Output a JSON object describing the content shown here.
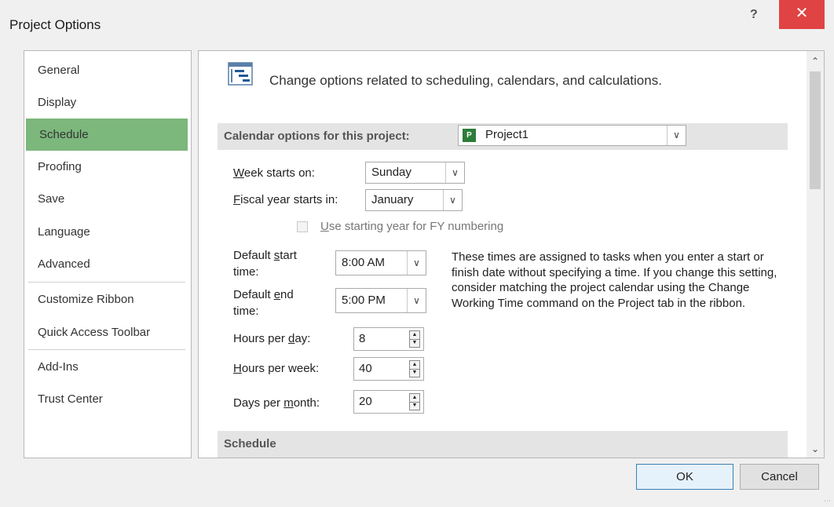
{
  "window": {
    "title": "Project Options",
    "help_label": "?",
    "close_label": "✕"
  },
  "nav": {
    "items": [
      {
        "label": "General"
      },
      {
        "label": "Display"
      },
      {
        "label": "Schedule",
        "selected": true
      },
      {
        "label": "Proofing"
      },
      {
        "label": "Save"
      },
      {
        "label": "Language"
      },
      {
        "label": "Advanced"
      },
      {
        "label": "Customize Ribbon"
      },
      {
        "label": "Quick Access Toolbar"
      },
      {
        "label": "Add-Ins"
      },
      {
        "label": "Trust Center"
      }
    ]
  },
  "main": {
    "header": "Change options related to scheduling, calendars, and calculations.",
    "calendar_section": {
      "label": "Calendar options for this project:",
      "project_value": "Project1"
    },
    "week_starts": {
      "label_pre": "",
      "label_u": "W",
      "label_post": "eek starts on:",
      "value": "Sunday"
    },
    "fiscal_year": {
      "label_u": "F",
      "label_post": "iscal year starts in:",
      "value": "January"
    },
    "use_starting_year": {
      "label_u": "U",
      "label_post": "se starting year for FY numbering",
      "checked": false
    },
    "default_start": {
      "label_l1_pre": "Default ",
      "label_l1_u": "s",
      "label_l1_post": "tart",
      "label_l2": "time:",
      "value": "8:00 AM"
    },
    "default_end": {
      "label_l1_pre": "Default ",
      "label_l1_u": "e",
      "label_l1_post": "nd",
      "label_l2": "time:",
      "value": "5:00 PM"
    },
    "hours_per_day": {
      "label_pre": "Hours per ",
      "label_u": "d",
      "label_post": "ay:",
      "value": "8"
    },
    "hours_per_week": {
      "label_pre": "",
      "label_u": "H",
      "label_post": "ours per week:",
      "value": "40"
    },
    "days_per_month": {
      "label_pre": "Days per ",
      "label_u": "m",
      "label_post": "onth:",
      "value": "20"
    },
    "note": "These times are assigned to tasks when you enter a start or finish date without specifying a time. If you change this setting, consider matching the project calendar using the Change Working Time command on the Project tab in the ribbon.",
    "schedule_section": {
      "label": "Schedule"
    }
  },
  "buttons": {
    "ok": "OK",
    "cancel": "Cancel"
  },
  "colors": {
    "nav_selected": "#7cb77c",
    "close_button": "#e04343"
  }
}
